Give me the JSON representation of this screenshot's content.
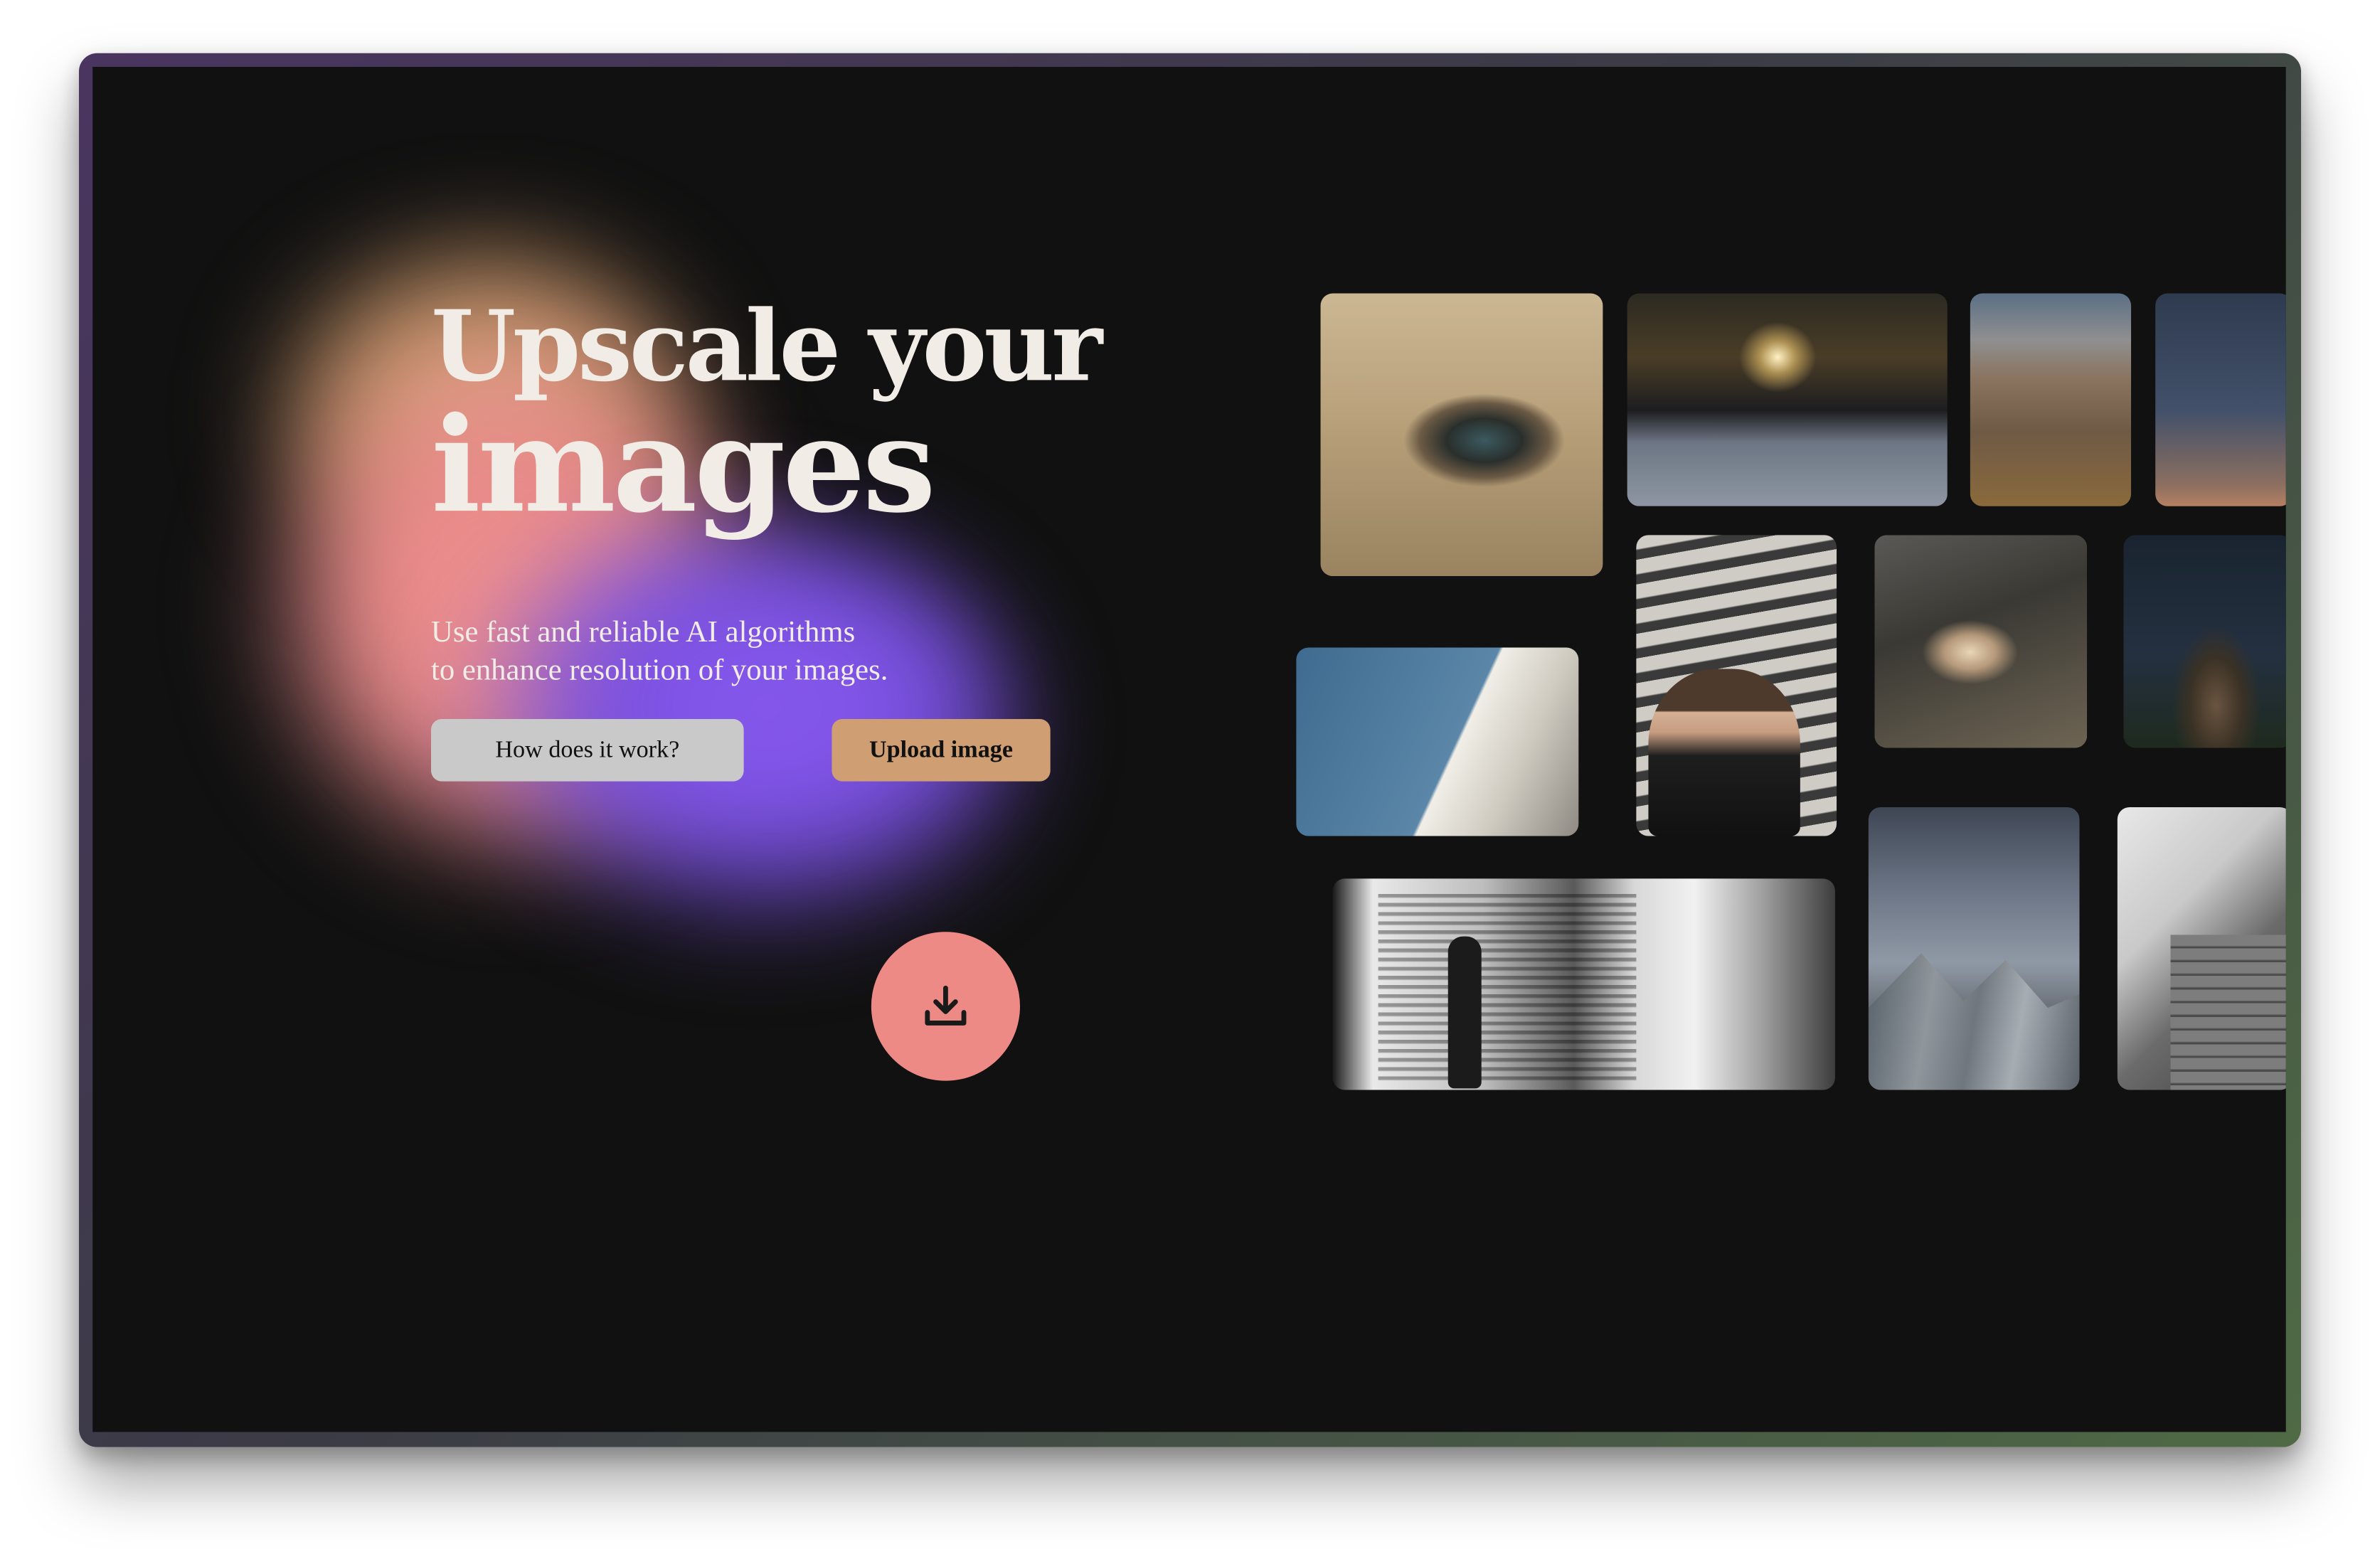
{
  "hero": {
    "title_line1": "Upscale your",
    "title_line2": "images",
    "subtitle_line1": "Use fast and reliable AI algorithms",
    "subtitle_line2": "to enhance resolution of your images."
  },
  "actions": {
    "how_label": "How does it work?",
    "upload_label": "Upload image",
    "download_icon": "download-icon"
  },
  "gallery": {
    "images": [
      "eye-closeup",
      "car-sunset",
      "rolling-hills",
      "birds-dusk",
      "white-building-sky",
      "photographer",
      "phone-light",
      "church-cross-night",
      "woman-stairs-bw",
      "cloudy-tower",
      "brick-wall-bw"
    ]
  },
  "colors": {
    "background": "#111111",
    "text": "#f1ece6",
    "button_secondary": "#c9c9c9",
    "button_primary": "#cf9e73",
    "download_button": "#ee8a86",
    "glow_pink": "#f2928c",
    "glow_purple": "#8a5af0",
    "glow_gold": "#e6b08f"
  }
}
